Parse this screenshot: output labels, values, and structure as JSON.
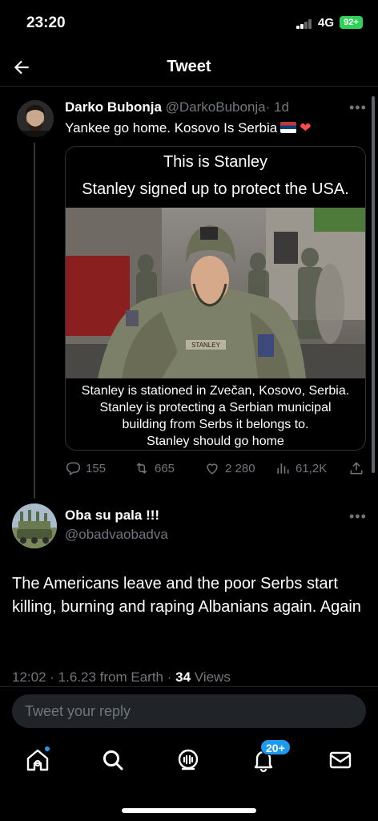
{
  "status_bar": {
    "time": "23:20",
    "network": "4G",
    "battery": "92+"
  },
  "header": {
    "title": "Tweet"
  },
  "tweet": {
    "author_name": "Darko Bubonja",
    "handle": "@DarkoBubonja",
    "age": "· 1d",
    "text": "Yankee go home. Kosovo Is Serbia",
    "image": {
      "caption_top_1": "This is Stanley",
      "caption_top_2": "Stanley signed up to protect the USA.",
      "name_tape": "STANLEY",
      "caption_bottom_1": "Stanley is stationed in Zvečan, Kosovo, Serbia.",
      "caption_bottom_2": "Stanley is protecting a Serbian municipal",
      "caption_bottom_3": "building from Serbs it belongs to.",
      "caption_bottom_4": "Stanley should go home"
    },
    "stats": {
      "replies": "155",
      "retweets": "665",
      "likes": "2 280",
      "views": "61,2K"
    }
  },
  "reply": {
    "author_name": "Oba su pala !!!",
    "handle": "@obadvaobadva",
    "text": "The Americans leave and the poor Serbs start killing, burning and raping Albanians again. Again",
    "meta": "12:02 · 1.6.23 from Earth ·",
    "views_count": "34",
    "views_label": "Views"
  },
  "reply_input": {
    "placeholder": "Tweet your reply"
  },
  "bottom_nav": {
    "notifications_badge": "20+"
  },
  "icons": [
    "back-arrow-icon",
    "more-icon",
    "reply-icon",
    "retweet-icon",
    "like-icon",
    "views-icon",
    "share-icon",
    "home-icon",
    "search-icon",
    "spaces-icon",
    "notifications-icon",
    "messages-icon"
  ],
  "colors": {
    "accent": "#1d9bf0",
    "muted": "#71767b",
    "background": "#000000"
  }
}
